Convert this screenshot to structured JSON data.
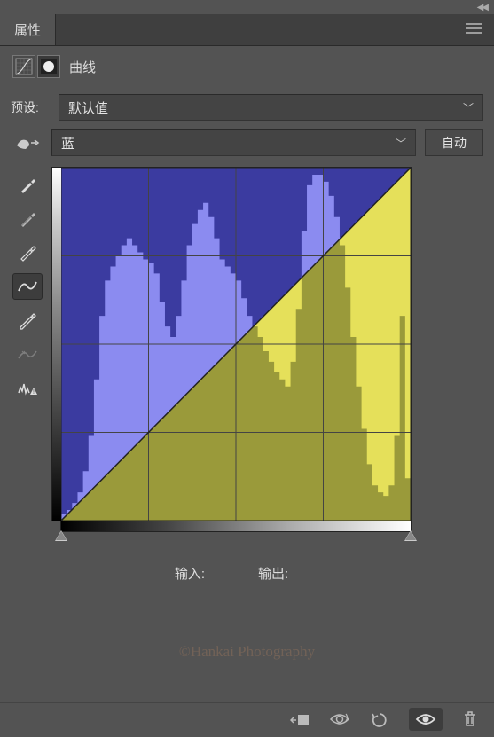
{
  "panel": {
    "title": "属性",
    "adjustment_type": "曲线"
  },
  "preset": {
    "label": "预设:",
    "value": "默认值"
  },
  "channel": {
    "value": "蓝",
    "auto_button": "自动"
  },
  "io": {
    "input_label": "输入:",
    "output_label": "输出:"
  },
  "watermark": "©Hankai Photography",
  "chart_data": {
    "type": "curves_histogram",
    "channel": "blue",
    "grid_divisions": 4,
    "curve_points": [
      [
        0,
        0
      ],
      [
        255,
        255
      ]
    ],
    "diagonal": "identity",
    "input_range": [
      0,
      255
    ],
    "output_range": [
      0,
      255
    ],
    "black_point": 0,
    "white_point": 255,
    "histogram_bins": 64,
    "histogram_values": [
      2,
      3,
      5,
      8,
      14,
      24,
      40,
      58,
      68,
      72,
      75,
      78,
      80,
      78,
      76,
      74,
      73,
      70,
      62,
      55,
      52,
      58,
      68,
      78,
      84,
      88,
      90,
      86,
      80,
      74,
      72,
      70,
      68,
      63,
      58,
      55,
      52,
      48,
      45,
      42,
      40,
      38,
      45,
      60,
      82,
      95,
      98,
      98,
      96,
      92,
      86,
      78,
      66,
      52,
      38,
      26,
      16,
      10,
      8,
      7,
      10,
      24,
      58,
      12
    ],
    "histogram_max": 100
  }
}
